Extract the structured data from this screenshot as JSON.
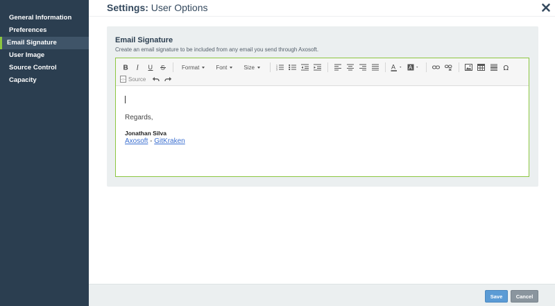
{
  "sidebar": {
    "items": [
      {
        "label": "General Information"
      },
      {
        "label": "Preferences"
      },
      {
        "label": "Email Signature"
      },
      {
        "label": "User Image"
      },
      {
        "label": "Source Control"
      },
      {
        "label": "Capacity"
      }
    ],
    "active_index": 2
  },
  "header": {
    "title_bold": "Settings:",
    "title_rest": " User Options"
  },
  "panel": {
    "title": "Email Signature",
    "description": "Create an email signature to be included from any email you send through Axosoft."
  },
  "toolbar": {
    "format_label": "Format",
    "font_label": "Font",
    "size_label": "Size",
    "source_label": "Source"
  },
  "signature": {
    "regards": "Regards,",
    "name": "Jonathan Silva",
    "link1": "Axosoft",
    "separator": " - ",
    "link2": "GitKraken"
  },
  "footer": {
    "save_label": "Save",
    "cancel_label": "Cancel"
  },
  "colors": {
    "sidebar_bg": "#2b3e50",
    "accent_green": "#8cc63f",
    "save_blue": "#5b9bd5",
    "cancel_gray": "#8a959e"
  }
}
